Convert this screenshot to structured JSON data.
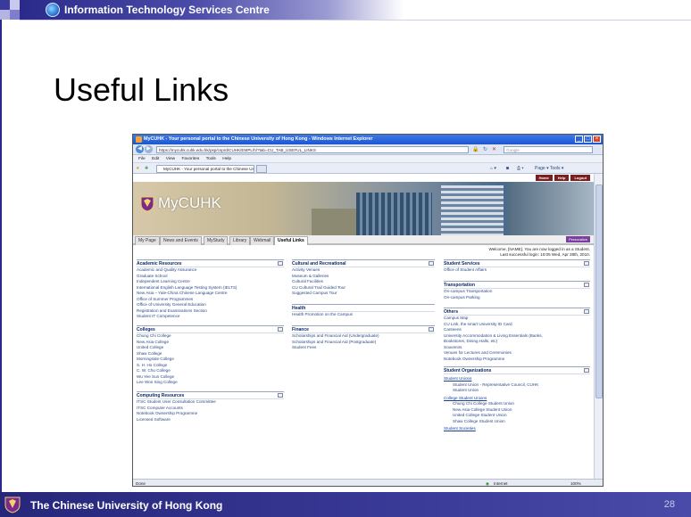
{
  "header": {
    "text": "Information Technology Services Centre"
  },
  "slide": {
    "title": "Useful Links",
    "page_number": "28"
  },
  "footer": {
    "text": "The Chinese University of Hong Kong"
  },
  "browser": {
    "window_title": "MyCUHK - Your personal portal to the Chinese University of Hong Kong - Windows Internet Explorer",
    "url": "https://mycuhk.cuhk.edu.hk/psp/csprd/CUHK/EMPL/h/?tab=CU_TAB_USEFUL_LINKS",
    "search_placeholder": "Google",
    "menu": [
      "File",
      "Edit",
      "View",
      "Favorites",
      "Tools",
      "Help"
    ],
    "tab_label": "MyCUHK - Your personal portal to the Chinese Univer...",
    "toolbar_right": "Page ▾  Tools ▾",
    "status_left": "Done",
    "status_zone": "Internet",
    "status_zoom": "100%"
  },
  "portal": {
    "top_links": [
      "Home",
      "Help",
      "Logout"
    ],
    "banner_text": "MyCUHK",
    "tabs": [
      "My Page",
      "News and Events",
      "MyStudy",
      "Library",
      "Webmail",
      "Useful Links"
    ],
    "tab_right": "Personalize",
    "welcome_line1": "Welcome, [NAME]. You are now logged in as a Student.",
    "welcome_line2": "Last successful login: 10:05 Wed, Apr 28th, 2010."
  },
  "panels": {
    "academic": {
      "title": "Academic Resources",
      "items": [
        "Academic and Quality Assurance",
        "Graduate School",
        "Independent Learning Centre",
        "International English Language Testing System (IELTS)",
        "New Asia – Yale-China Chinese Language Centre",
        "Office of Summer Programmes",
        "Office of University General Education",
        "Registration and Examinations Section",
        "Student IT Competence"
      ]
    },
    "colleges": {
      "title": "Colleges",
      "items": [
        "Chung Chi College",
        "New Asia College",
        "United College",
        "Shaw College",
        "Morningside College",
        "S. H. Ho College",
        "C. W. Chu College",
        "Wu Yee Sun College",
        "Lee Woo Sing College"
      ]
    },
    "computing": {
      "title": "Computing Resources",
      "items": [
        "ITSC Student User Consultation Committee",
        "ITSC Computer Accounts",
        "Notebook Ownership Programme",
        "Licensed Software"
      ]
    },
    "cultural": {
      "title": "Cultural and Recreational",
      "items": [
        "Activity Venues",
        "Museum & Galleries",
        "Cultural Facilities",
        "CU Cultural Trail Guided Tour",
        "Suggested Campus Tour"
      ]
    },
    "health": {
      "title": "Health",
      "items": [
        "Health Promotion on the Campus"
      ]
    },
    "finance": {
      "title": "Finance",
      "items": [
        "Scholarships and Financial Aid (Undergraduate)",
        "Scholarships and Financial Aid (Postgraduate)",
        "Student Fees"
      ]
    },
    "student_services": {
      "title": "Student Services",
      "items": [
        "Office of Student Affairs"
      ]
    },
    "transportation": {
      "title": "Transportation",
      "items": [
        "On-campus Transportation",
        "On-campus Parking"
      ]
    },
    "others": {
      "title": "Others",
      "items": [
        "Campus Map",
        "CU Link, the smart University ID Card",
        "Canteens",
        "University Accommodation & Living Essentials (Banks,",
        "Bookstores, Dining Halls, etc)",
        "Souvenirs",
        "Venues for Lectures and Ceremonies",
        "Notebook Ownership Programme"
      ]
    },
    "organizations": {
      "title": "Student Organizations",
      "group1_title": "Student Unions",
      "group1_items": [
        "Student Union - Representative Council, CUHK",
        "Student Union"
      ],
      "group2_title": "College Student Unions",
      "group2_items": [
        "Chung Chi College Student Union",
        "New Asia College Student Union",
        "United College Student Union",
        "Shaw College Student Union"
      ],
      "group3_title": "Student Societies"
    }
  }
}
